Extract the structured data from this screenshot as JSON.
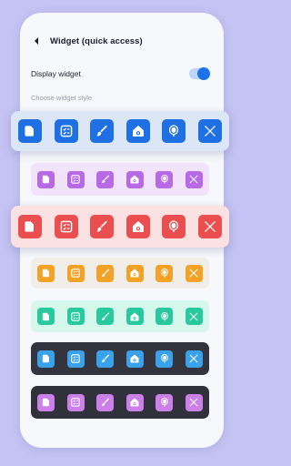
{
  "header": {
    "title": "Widget (quick access)",
    "back_icon": "chevron-left-icon"
  },
  "display_widget": {
    "label": "Display widget",
    "enabled": true
  },
  "choose_label": "Choose widget style",
  "icons": [
    "note-icon",
    "checklist-icon",
    "brush-icon",
    "camera-icon",
    "microphone-icon",
    "close-icon"
  ],
  "styles": [
    {
      "name": "blue",
      "selected": true,
      "tile": "#1f6fe5",
      "fg": "#ffffff",
      "bg": "#dbe7f7"
    },
    {
      "name": "purple",
      "selected": false,
      "tile": "#b86ae6",
      "fg": "#ffffff",
      "bg": "#f1e3fb"
    },
    {
      "name": "red",
      "selected": true,
      "tile": "#ea4e4e",
      "fg": "#ffffff",
      "bg": "#fbe1e1"
    },
    {
      "name": "orange",
      "selected": false,
      "tile": "#f2a227",
      "fg": "#ffffff",
      "bg": "#f1ede8"
    },
    {
      "name": "green",
      "selected": false,
      "tile": "#27c99d",
      "fg": "#ffffff",
      "bg": "#d6f7ec"
    },
    {
      "name": "dark",
      "selected": false,
      "tile": "#3aa2ea",
      "fg": "#ffffff",
      "bg": "#33343d"
    },
    {
      "name": "violet",
      "selected": false,
      "tile": "#cc7ee9",
      "fg": "#ffffff",
      "bg": "#30313a"
    }
  ]
}
